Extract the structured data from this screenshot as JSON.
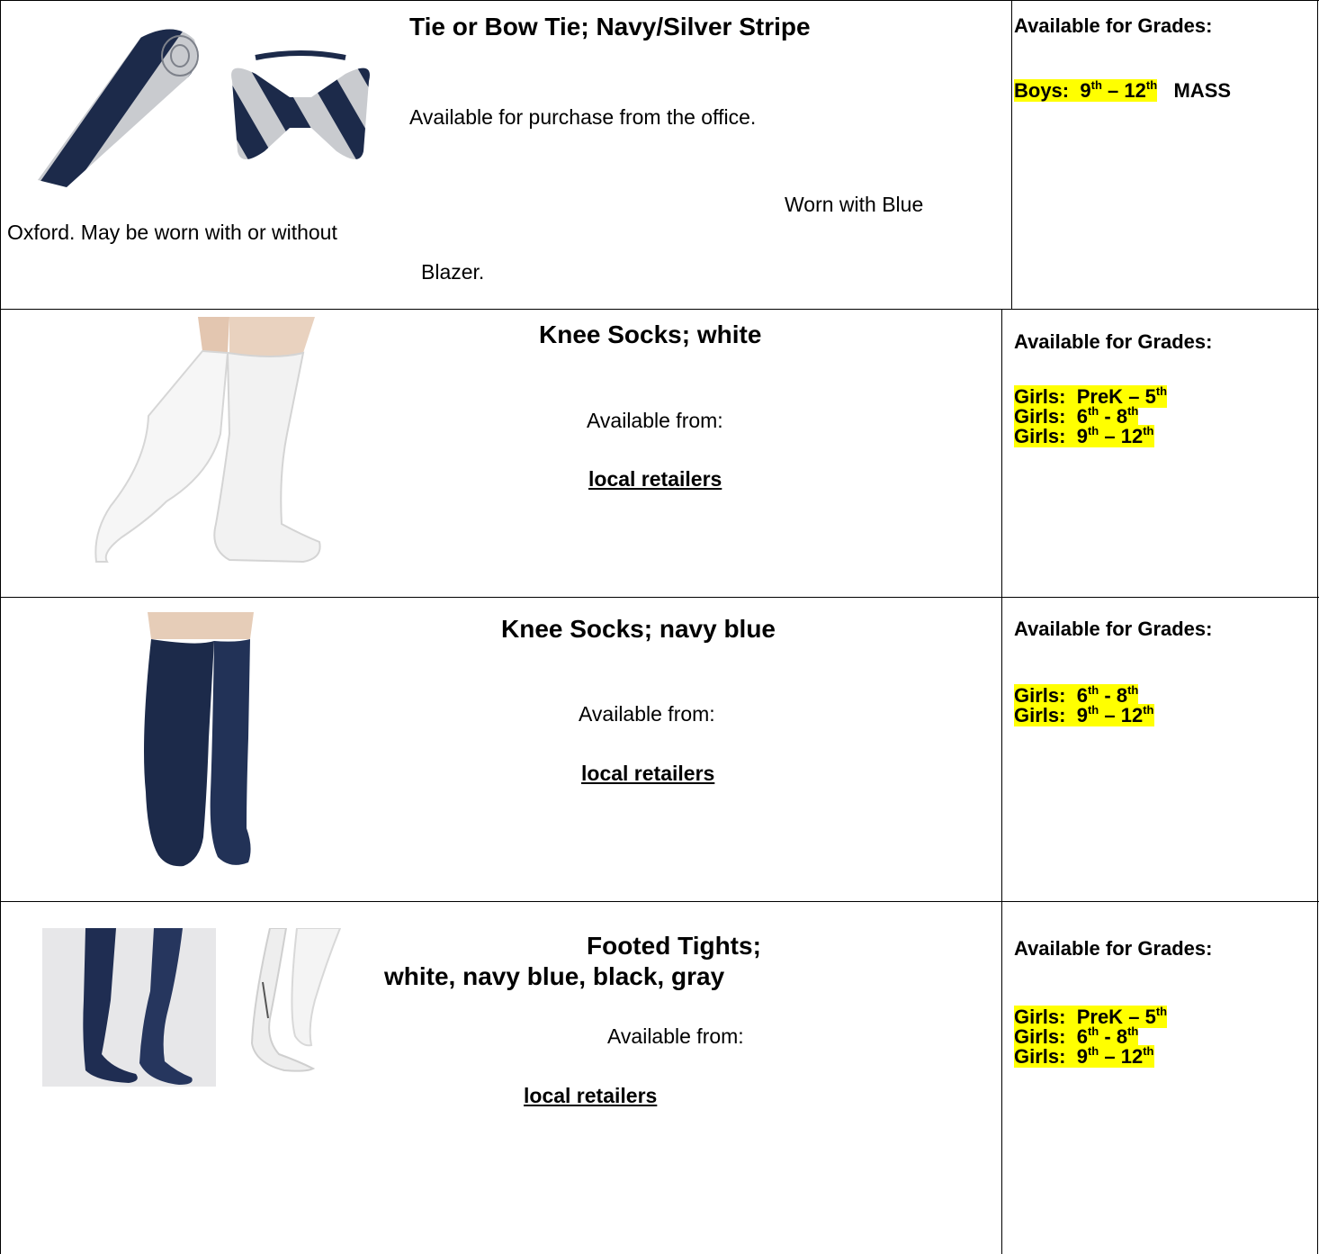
{
  "rows": [
    {
      "title": "Tie or Bow Tie; Navy/Silver Stripe",
      "text1": "Available for purchase from the office.",
      "note_a": "Worn with Blue",
      "note_b": "Oxford.  May be worn with or without",
      "note_c": "Blazer.",
      "avail_label": "Available for Grades:",
      "grades": [
        {
          "prefix": "Boys:",
          "from": "9",
          "from_sup": "th",
          "sep": "–",
          "to": "12",
          "to_sup": "th",
          "suffix": "MASS"
        }
      ]
    },
    {
      "title": "Knee Socks; white",
      "text1": "Available from:",
      "link": "local retailers",
      "avail_label": "Available for Grades:",
      "grades": [
        {
          "prefix": "Girls:",
          "from": "PreK",
          "from_sup": "",
          "sep": "–",
          "to": "5",
          "to_sup": "th"
        },
        {
          "prefix": "Girls:",
          "from": "6",
          "from_sup": "th",
          "sep": "-",
          "to": "8",
          "to_sup": "th"
        },
        {
          "prefix": "Girls:",
          "from": "9",
          "from_sup": "th",
          "sep": "–",
          "to": "12",
          "to_sup": "th"
        }
      ]
    },
    {
      "title": "Knee Socks; navy blue",
      "text1": "Available from:",
      "link": "local retailers",
      "avail_label": "Available for Grades:",
      "grades": [
        {
          "prefix": "Girls:",
          "from": "6",
          "from_sup": "th",
          "sep": "-",
          "to": "8",
          "to_sup": "th"
        },
        {
          "prefix": "Girls:",
          "from": "9",
          "from_sup": "th",
          "sep": "–",
          "to": "12",
          "to_sup": "th"
        }
      ]
    },
    {
      "title": "Footed Tights;",
      "subtitle": "white, navy blue, black, gray",
      "text1": "Available from:",
      "link": "local retailers",
      "avail_label": "Available for Grades:",
      "grades": [
        {
          "prefix": "Girls:",
          "from": "PreK",
          "from_sup": "",
          "sep": "–",
          "to": "5",
          "to_sup": "th"
        },
        {
          "prefix": "Girls:",
          "from": "6",
          "from_sup": "th",
          "sep": "-",
          "to": "8",
          "to_sup": "th"
        },
        {
          "prefix": "Girls:",
          "from": "9",
          "from_sup": "th",
          "sep": "–",
          "to": "12",
          "to_sup": "th"
        }
      ]
    }
  ],
  "colors": {
    "highlight": "#ffff00",
    "navy": "#1c2a4a",
    "silver": "#c9cbcf",
    "border": "#000000"
  }
}
